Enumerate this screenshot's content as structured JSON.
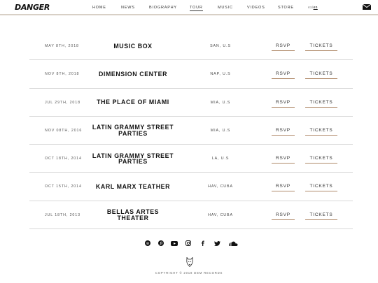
{
  "header": {
    "logo": "DANGER",
    "nav": [
      {
        "label": "HOME"
      },
      {
        "label": "NEWS"
      },
      {
        "label": "BIOGRAPHY"
      },
      {
        "label": "TOUR"
      },
      {
        "label": "MUSIC"
      },
      {
        "label": "VIDEOS"
      },
      {
        "label": "STORE"
      }
    ],
    "active_nav": "TOUR",
    "lang": {
      "es": "es",
      "sep": "/",
      "en": "en"
    },
    "mail_icon": "envelope-icon"
  },
  "events": [
    {
      "date": "MAY 8TH, 2018",
      "venue": "MUSIC BOX",
      "location": "SAN, U.S",
      "rsvp": "RSVP",
      "tickets": "TICKETS"
    },
    {
      "date": "NOV 8TH, 2018",
      "venue": "DIMENSION CENTER",
      "location": "NAP, U.S",
      "rsvp": "RSVP",
      "tickets": "TICKETS"
    },
    {
      "date": "JUL 29TH, 2018",
      "venue": "THE PLACE OF MIAMI",
      "location": "MIA, U.S",
      "rsvp": "RSVP",
      "tickets": "TICKETS"
    },
    {
      "date": "NOV 08TH, 2016",
      "venue": "LATIN GRAMMY STREET PARTIES",
      "location": "MIA, U.S",
      "rsvp": "RSVP",
      "tickets": "TICKETS"
    },
    {
      "date": "OCT 18TH, 2014",
      "venue": "LATIN GRAMMY STREET PARTIES",
      "location": "LA, U.S",
      "rsvp": "RSVP",
      "tickets": "TICKETS"
    },
    {
      "date": "OCT 15TH, 2014",
      "venue": "KARL MARX TEATHER",
      "location": "HAV, CUBA",
      "rsvp": "RSVP",
      "tickets": "TICKETS"
    },
    {
      "date": "JUL 18TH, 2013",
      "venue": "BELLAS ARTES THEATER",
      "location": "HAV, CUBA",
      "rsvp": "RSVP",
      "tickets": "TICKETS"
    }
  ],
  "social": [
    "spotify-icon",
    "itunes-icon",
    "youtube-icon",
    "instagram-icon",
    "facebook-icon",
    "twitter-icon",
    "soundcloud-icon"
  ],
  "footer": {
    "copyright": "COPYRIGHT © 2018 DEM RECORDS"
  },
  "colors": {
    "accent": "#b08a6a",
    "divider": "#d8d8d8",
    "text": "#111111"
  }
}
